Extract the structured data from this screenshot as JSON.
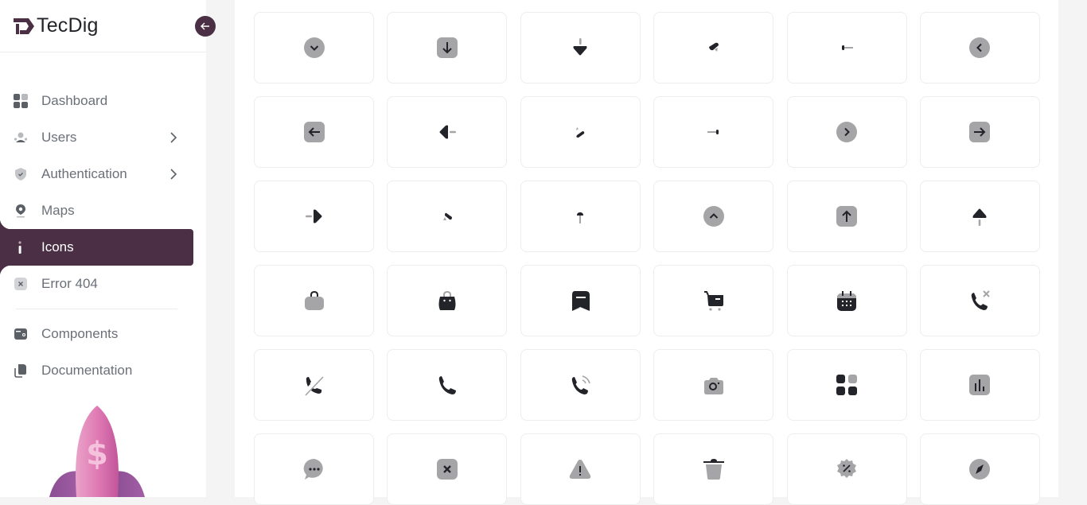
{
  "app": {
    "brand": "TecDig",
    "accent_color": "#4a2f45"
  },
  "sidebar": {
    "collapse_button_icon": "arrow-left-icon",
    "items": [
      {
        "label": "Dashboard",
        "icon": "dashboard-icon",
        "has_submenu": false,
        "active": false
      },
      {
        "label": "Users",
        "icon": "users-icon",
        "has_submenu": true,
        "active": false
      },
      {
        "label": "Authentication",
        "icon": "shield-check-icon",
        "has_submenu": true,
        "active": false
      },
      {
        "label": "Maps",
        "icon": "map-pin-icon",
        "has_submenu": false,
        "active": false
      },
      {
        "label": "Icons",
        "icon": "info-icon",
        "has_submenu": false,
        "active": true
      },
      {
        "label": "Error 404",
        "icon": "close-square-icon",
        "has_submenu": false,
        "active": false
      }
    ],
    "secondary_items": [
      {
        "label": "Components",
        "icon": "wallet-icon"
      },
      {
        "label": "Documentation",
        "icon": "copy-icon"
      }
    ],
    "promo_image": "rocket-dollar-illustration"
  },
  "icons": [
    "chevron-down-circle",
    "arrow-down-square",
    "arrow-down-triangle",
    "arrow-down-left-diagonal",
    "arrow-left-line",
    "chevron-left-circle",
    "arrow-left-square",
    "arrow-left-triangle",
    "arrow-up-left-diagonal",
    "arrow-right-line",
    "chevron-right-circle",
    "arrow-right-square",
    "arrow-right-triangle",
    "arrow-up-right-diagonal",
    "arrow-up-line",
    "chevron-up-circle",
    "arrow-up-square",
    "arrow-up-triangle",
    "bag-handle",
    "bag-smile",
    "bookmark-minus",
    "cart-minus",
    "calendar",
    "call-remove",
    "call-slash",
    "call",
    "call-calling",
    "camera",
    "category",
    "chart-square",
    "chat-dots",
    "close-square",
    "danger-triangle",
    "trash",
    "discount",
    "compass"
  ]
}
